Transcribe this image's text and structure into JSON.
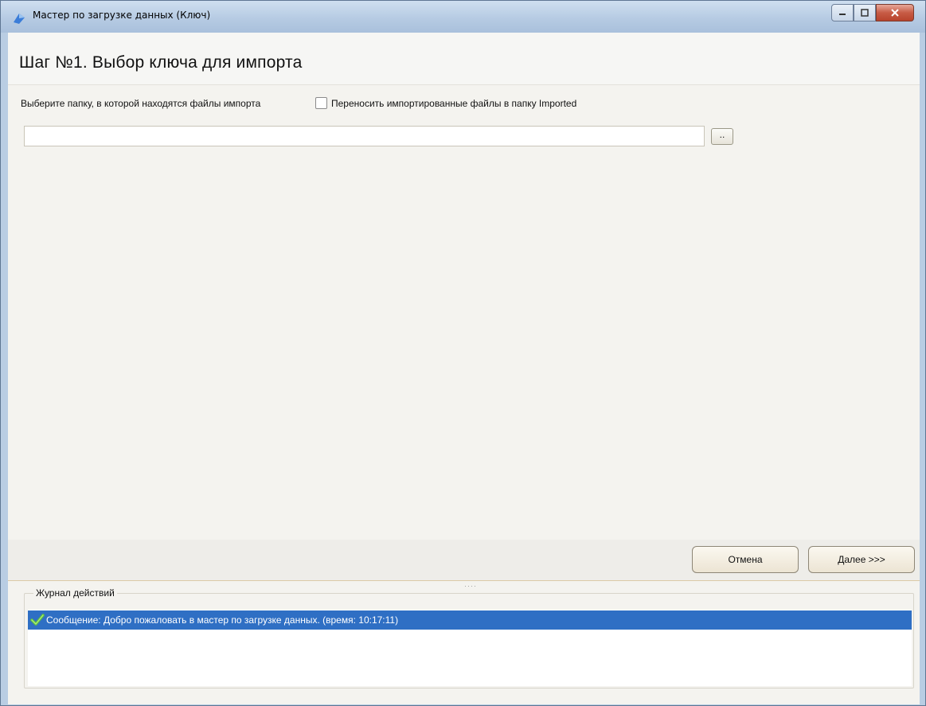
{
  "window": {
    "title": "Мастер по загрузке данных (Ключ)",
    "icon": "app-icon",
    "buttons": [
      "minimize-icon",
      "maximize-icon",
      "close-icon"
    ]
  },
  "header": {
    "title": "Шаг №1.  Выбор ключа для импорта"
  },
  "form": {
    "folder_label": "Выберите папку, в которой находятся файлы импорта",
    "move_checkbox_label": "Переносить импортированные файлы в папку Imported",
    "move_checkbox_checked": false,
    "path_value": "",
    "browse_label": ".."
  },
  "actions": {
    "cancel_label": "Отмена",
    "next_label": "Далее >>>"
  },
  "log": {
    "title": "Журнал действий",
    "entries": [
      {
        "icon": "checkmark-icon",
        "text": "Сообщение: Добро пожаловать в мастер по загрузке данных. (время: 10:17:11)",
        "selected": true
      }
    ]
  },
  "colors": {
    "selection": "#2f6fc4",
    "client_bg": "#f4f3ef",
    "checkmark": "#4caf2a"
  }
}
